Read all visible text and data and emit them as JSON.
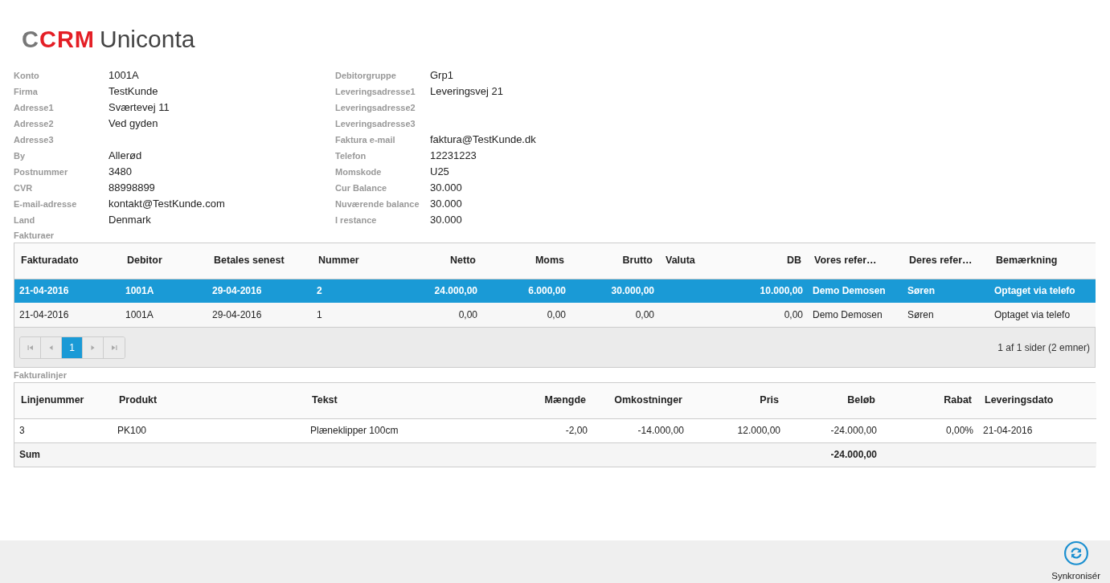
{
  "logo": {
    "mark": "C",
    "brand": "CRM",
    "name": "Uniconta"
  },
  "fields_left": [
    {
      "label": "Konto",
      "value": "1001A"
    },
    {
      "label": "Firma",
      "value": "TestKunde"
    },
    {
      "label": "Adresse1",
      "value": "Sværtevej 11"
    },
    {
      "label": "Adresse2",
      "value": "Ved gyden"
    },
    {
      "label": "Adresse3"
    },
    {
      "label": "By",
      "value": "Allerød"
    },
    {
      "label": "Postnummer",
      "value": "3480"
    },
    {
      "label": "CVR",
      "value": "88998899"
    },
    {
      "label": "E-mail-adresse",
      "value": "kontakt@TestKunde.com"
    },
    {
      "label": "Land",
      "value": "Denmark"
    }
  ],
  "fields_right": [
    {
      "label": "Debitorgruppe",
      "value": "Grp1"
    },
    {
      "label": "Leveringsadresse1",
      "value": "Leveringsvej 21"
    },
    {
      "label": "Leveringsadresse2"
    },
    {
      "label": "Leveringsadresse3"
    },
    {
      "label": "Faktura e-mail",
      "value": "faktura@TestKunde.dk"
    },
    {
      "label": "Telefon",
      "value": "12231223"
    },
    {
      "label": "Momskode",
      "value": "U25"
    },
    {
      "label": "Cur Balance",
      "value": "30.000"
    },
    {
      "label": "Nuværende balance",
      "value": "30.000"
    },
    {
      "label": "I restance",
      "value": "30.000"
    }
  ],
  "invoices": {
    "title": "Fakturaer",
    "columns": [
      {
        "label": "Fakturadato",
        "numeric": false
      },
      {
        "label": "Debitor",
        "numeric": false
      },
      {
        "label": "Betales senest",
        "numeric": false
      },
      {
        "label": "Nummer",
        "numeric": false
      },
      {
        "label": "Netto",
        "numeric": true
      },
      {
        "label": "Moms",
        "numeric": true
      },
      {
        "label": "Brutto",
        "numeric": true
      },
      {
        "label": "Valuta",
        "numeric": false
      },
      {
        "label": "DB",
        "numeric": true
      },
      {
        "label": "Vores refer…",
        "numeric": false
      },
      {
        "label": "Deres refer…",
        "numeric": false
      },
      {
        "label": "Bemærkning",
        "numeric": false
      }
    ],
    "rows": [
      {
        "selected": true,
        "cells": [
          "21-04-2016",
          "1001A",
          "29-04-2016",
          "2",
          "24.000,00",
          "6.000,00",
          "30.000,00",
          null,
          "10.000,00",
          "Demo Demosen",
          "Søren",
          "Optaget via telefo"
        ]
      },
      {
        "selected": false,
        "cells": [
          "21-04-2016",
          "1001A",
          "29-04-2016",
          "1",
          "0,00",
          "0,00",
          "0,00",
          null,
          "0,00",
          "Demo Demosen",
          "Søren",
          "Optaget via telefo"
        ]
      }
    ],
    "pager": {
      "pages": [
        {
          "label": "1",
          "selected": true
        }
      ],
      "info": "1 af 1 sider (2 emner)"
    }
  },
  "lines": {
    "title": "Fakturalinjer",
    "columns": [
      {
        "label": "Linjenummer",
        "numeric": false,
        "summed": false
      },
      {
        "label": "Produkt",
        "numeric": false,
        "summed": false
      },
      {
        "label": "Tekst",
        "numeric": false,
        "summed": false
      },
      {
        "label": "Mængde",
        "numeric": true,
        "summed": false
      },
      {
        "label": "Omkostninger",
        "numeric": true,
        "summed": false
      },
      {
        "label": "Pris",
        "numeric": true,
        "summed": false
      },
      {
        "label": "Beløb",
        "numeric": true,
        "summed": true
      },
      {
        "label": "Rabat",
        "numeric": true,
        "summed": false
      },
      {
        "label": "Leveringsdato",
        "numeric": false,
        "summed": false
      }
    ],
    "rows": [
      {
        "cells": [
          "3",
          "PK100",
          "Plæneklipper 100cm",
          "-2,00",
          "-14.000,00",
          "12.000,00",
          "-24.000,00",
          "0,00%",
          "21-04-2016"
        ]
      }
    ],
    "sum": {
      "label": "Sum",
      "values": [
        "-24.000,00"
      ]
    }
  },
  "footer": {
    "sync_label": "Synkronisér"
  }
}
